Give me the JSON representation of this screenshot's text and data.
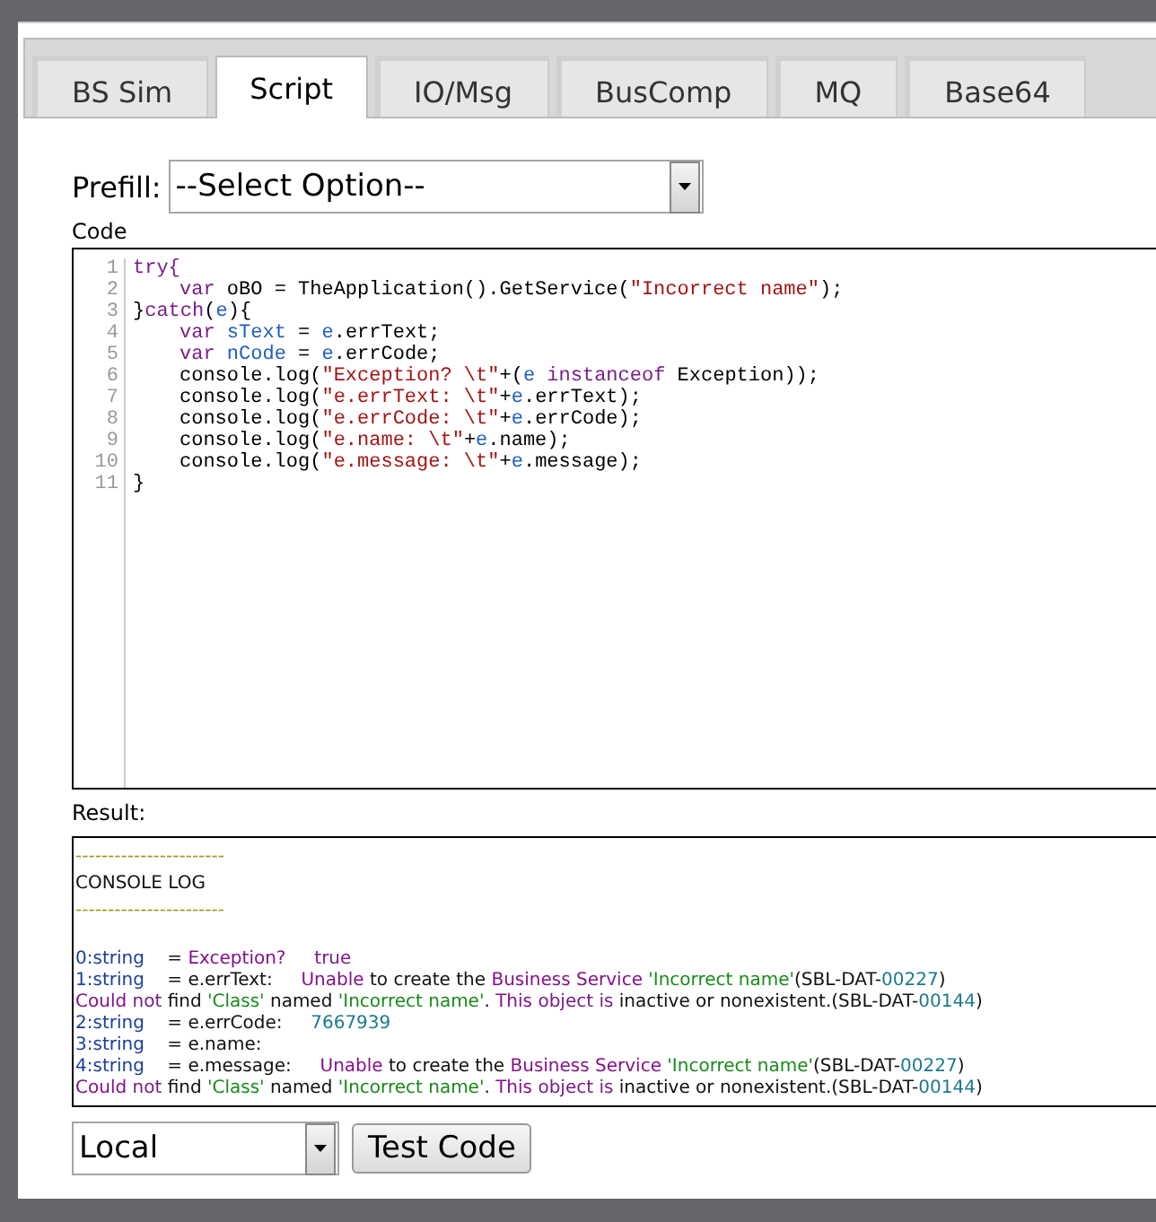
{
  "tabs": [
    {
      "label": "BS Sim",
      "selected": false
    },
    {
      "label": "Script",
      "selected": true
    },
    {
      "label": "IO/Msg",
      "selected": false
    },
    {
      "label": "BusComp",
      "selected": false
    },
    {
      "label": "MQ",
      "selected": false
    },
    {
      "label": "Base64",
      "selected": false
    }
  ],
  "prefill": {
    "label": "Prefill:",
    "value": "--Select Option--"
  },
  "code": {
    "label": "Code",
    "lines": [
      {
        "number": "1",
        "indent": false,
        "tokens": [
          {
            "text": "try{",
            "kind": "keyword"
          }
        ]
      },
      {
        "number": "2",
        "indent": true,
        "tokens": [
          {
            "text": "var",
            "kind": "keyword"
          },
          {
            "text": " oBO = TheApplication().GetService(",
            "kind": "plain"
          },
          {
            "text": "\"Incorrect name\"",
            "kind": "string"
          },
          {
            "text": ");",
            "kind": "plain"
          }
        ]
      },
      {
        "number": "3",
        "indent": false,
        "tokens": [
          {
            "text": "}",
            "kind": "plain"
          },
          {
            "text": "catch",
            "kind": "keyword"
          },
          {
            "text": "(",
            "kind": "plain"
          },
          {
            "text": "e",
            "kind": "variable"
          },
          {
            "text": "){",
            "kind": "plain"
          }
        ]
      },
      {
        "number": "4",
        "indent": true,
        "tokens": [
          {
            "text": "var",
            "kind": "keyword"
          },
          {
            "text": " sText",
            "kind": "variable"
          },
          {
            "text": " = ",
            "kind": "plain"
          },
          {
            "text": "e",
            "kind": "variable"
          },
          {
            "text": ".errText;",
            "kind": "plain"
          }
        ]
      },
      {
        "number": "5",
        "indent": true,
        "tokens": [
          {
            "text": "var",
            "kind": "keyword"
          },
          {
            "text": " nCode",
            "kind": "variable"
          },
          {
            "text": " = ",
            "kind": "plain"
          },
          {
            "text": "e",
            "kind": "variable"
          },
          {
            "text": ".errCode;",
            "kind": "plain"
          }
        ]
      },
      {
        "number": "6",
        "indent": true,
        "tokens": [
          {
            "text": "console.log(",
            "kind": "plain"
          },
          {
            "text": "\"Exception? \\t\"",
            "kind": "string"
          },
          {
            "text": "+(",
            "kind": "plain"
          },
          {
            "text": "e",
            "kind": "variable"
          },
          {
            "text": " instanceof",
            "kind": "keyword"
          },
          {
            "text": " Exception));",
            "kind": "plain"
          }
        ]
      },
      {
        "number": "7",
        "indent": true,
        "tokens": [
          {
            "text": "console.log(",
            "kind": "plain"
          },
          {
            "text": "\"e.errText: \\t\"",
            "kind": "string"
          },
          {
            "text": "+",
            "kind": "plain"
          },
          {
            "text": "e",
            "kind": "variable"
          },
          {
            "text": ".errText);",
            "kind": "plain"
          }
        ]
      },
      {
        "number": "8",
        "indent": true,
        "tokens": [
          {
            "text": "console.log(",
            "kind": "plain"
          },
          {
            "text": "\"e.errCode: \\t\"",
            "kind": "string"
          },
          {
            "text": "+",
            "kind": "plain"
          },
          {
            "text": "e",
            "kind": "variable"
          },
          {
            "text": ".errCode);",
            "kind": "plain"
          }
        ]
      },
      {
        "number": "9",
        "indent": true,
        "tokens": [
          {
            "text": "console.log(",
            "kind": "plain"
          },
          {
            "text": "\"e.name: \\t\"",
            "kind": "string"
          },
          {
            "text": "+",
            "kind": "plain"
          },
          {
            "text": "e",
            "kind": "variable"
          },
          {
            "text": ".name);",
            "kind": "plain"
          }
        ]
      },
      {
        "number": "10",
        "indent": true,
        "tokens": [
          {
            "text": "console.log(",
            "kind": "plain"
          },
          {
            "text": "\"e.message: \\t\"",
            "kind": "string"
          },
          {
            "text": "+",
            "kind": "plain"
          },
          {
            "text": "e",
            "kind": "variable"
          },
          {
            "text": ".message);",
            "kind": "plain"
          }
        ]
      },
      {
        "number": "11",
        "indent": false,
        "tokens": [
          {
            "text": "}",
            "kind": "plain"
          }
        ]
      }
    ]
  },
  "result": {
    "label": "Result:",
    "lines": [
      {
        "spaced": false,
        "tokens": [
          {
            "text": "-----------------------",
            "kind": "rule"
          }
        ]
      },
      {
        "spaced": false,
        "tokens": [
          {
            "text": "CONSOLE LOG",
            "kind": "text"
          }
        ]
      },
      {
        "spaced": false,
        "tokens": [
          {
            "text": "-----------------------",
            "kind": "rule"
          }
        ]
      },
      {
        "spaced": true,
        "tokens": [
          {
            "text": "0:string",
            "kind": "label"
          },
          {
            "text": "    = ",
            "kind": "text"
          },
          {
            "text": "Exception?",
            "kind": "name"
          },
          {
            "text": "     true",
            "kind": "keyword"
          }
        ]
      },
      {
        "spaced": false,
        "tokens": [
          {
            "text": "1:string",
            "kind": "label"
          },
          {
            "text": "    = e.errText:     ",
            "kind": "text"
          },
          {
            "text": "Unable",
            "kind": "name"
          },
          {
            "text": " to create the ",
            "kind": "text"
          },
          {
            "text": "Business Service",
            "kind": "name"
          },
          {
            "text": " 'Incorrect name'",
            "kind": "quoted"
          },
          {
            "text": "(SBL-DAT-",
            "kind": "text"
          },
          {
            "text": "00227",
            "kind": "number"
          },
          {
            "text": ")",
            "kind": "text"
          }
        ]
      },
      {
        "spaced": false,
        "tokens": [
          {
            "text": "Could",
            "kind": "name"
          },
          {
            "text": " not",
            "kind": "keyword"
          },
          {
            "text": " find ",
            "kind": "text"
          },
          {
            "text": "'Class'",
            "kind": "quoted"
          },
          {
            "text": " named ",
            "kind": "text"
          },
          {
            "text": "'Incorrect name'",
            "kind": "quoted"
          },
          {
            "text": ". ",
            "kind": "text"
          },
          {
            "text": "This",
            "kind": "name"
          },
          {
            "text": " object is",
            "kind": "keyword"
          },
          {
            "text": " inactive or nonexistent.(SBL-DAT-",
            "kind": "text"
          },
          {
            "text": "00144",
            "kind": "number"
          },
          {
            "text": ")",
            "kind": "text"
          }
        ]
      },
      {
        "spaced": false,
        "tokens": [
          {
            "text": "2:string",
            "kind": "label"
          },
          {
            "text": "    = e.errCode:     ",
            "kind": "text"
          },
          {
            "text": "7667939",
            "kind": "number"
          }
        ]
      },
      {
        "spaced": false,
        "tokens": [
          {
            "text": "3:string",
            "kind": "label"
          },
          {
            "text": "    = e.name:",
            "kind": "text"
          }
        ]
      },
      {
        "spaced": false,
        "tokens": [
          {
            "text": "4:string",
            "kind": "label"
          },
          {
            "text": "    = e.message:     ",
            "kind": "text"
          },
          {
            "text": "Unable",
            "kind": "name"
          },
          {
            "text": " to create the ",
            "kind": "text"
          },
          {
            "text": "Business Service",
            "kind": "name"
          },
          {
            "text": " 'Incorrect name'",
            "kind": "quoted"
          },
          {
            "text": "(SBL-DAT-",
            "kind": "text"
          },
          {
            "text": "00227",
            "kind": "number"
          },
          {
            "text": ")",
            "kind": "text"
          }
        ]
      },
      {
        "spaced": false,
        "tokens": [
          {
            "text": "Could",
            "kind": "name"
          },
          {
            "text": " not",
            "kind": "keyword"
          },
          {
            "text": " find ",
            "kind": "text"
          },
          {
            "text": "'Class'",
            "kind": "quoted"
          },
          {
            "text": " named ",
            "kind": "text"
          },
          {
            "text": "'Incorrect name'",
            "kind": "quoted"
          },
          {
            "text": ". ",
            "kind": "text"
          },
          {
            "text": "This",
            "kind": "name"
          },
          {
            "text": " object is",
            "kind": "keyword"
          },
          {
            "text": " inactive or nonexistent.(SBL-DAT-",
            "kind": "text"
          },
          {
            "text": "00144",
            "kind": "number"
          },
          {
            "text": ")",
            "kind": "text"
          }
        ]
      }
    ]
  },
  "target": {
    "value": "Local"
  },
  "buttons": [
    "Test Code"
  ]
}
